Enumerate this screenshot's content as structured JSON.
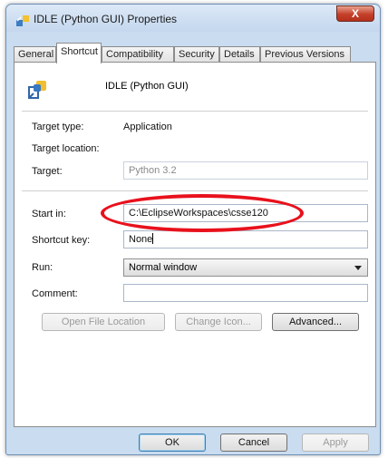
{
  "window": {
    "title": "IDLE (Python GUI) Properties",
    "close_label": "X"
  },
  "tabs": [
    {
      "label": "General",
      "active": false
    },
    {
      "label": "Shortcut",
      "active": true
    },
    {
      "label": "Compatibility",
      "active": false
    },
    {
      "label": "Security",
      "active": false
    },
    {
      "label": "Details",
      "active": false
    },
    {
      "label": "Previous Versions",
      "active": false
    }
  ],
  "shortcut": {
    "app_name": "IDLE (Python GUI)",
    "target_type_label": "Target type:",
    "target_type_value": "Application",
    "target_location_label": "Target location:",
    "target_label": "Target:",
    "target_value": "Python 3.2",
    "start_in_label": "Start in:",
    "start_in_value": "C:\\EclipseWorkspaces\\csse120",
    "shortcut_key_label": "Shortcut key:",
    "shortcut_key_value": "None",
    "run_label": "Run:",
    "run_value": "Normal window",
    "comment_label": "Comment:",
    "comment_value": "",
    "open_file_location_label": "Open File Location",
    "change_icon_label": "Change Icon...",
    "advanced_label": "Advanced..."
  },
  "footer": {
    "ok_label": "OK",
    "cancel_label": "Cancel",
    "apply_label": "Apply"
  },
  "colors": {
    "annotation_ellipse": "#e8111c",
    "close_button": "#c4402a"
  }
}
